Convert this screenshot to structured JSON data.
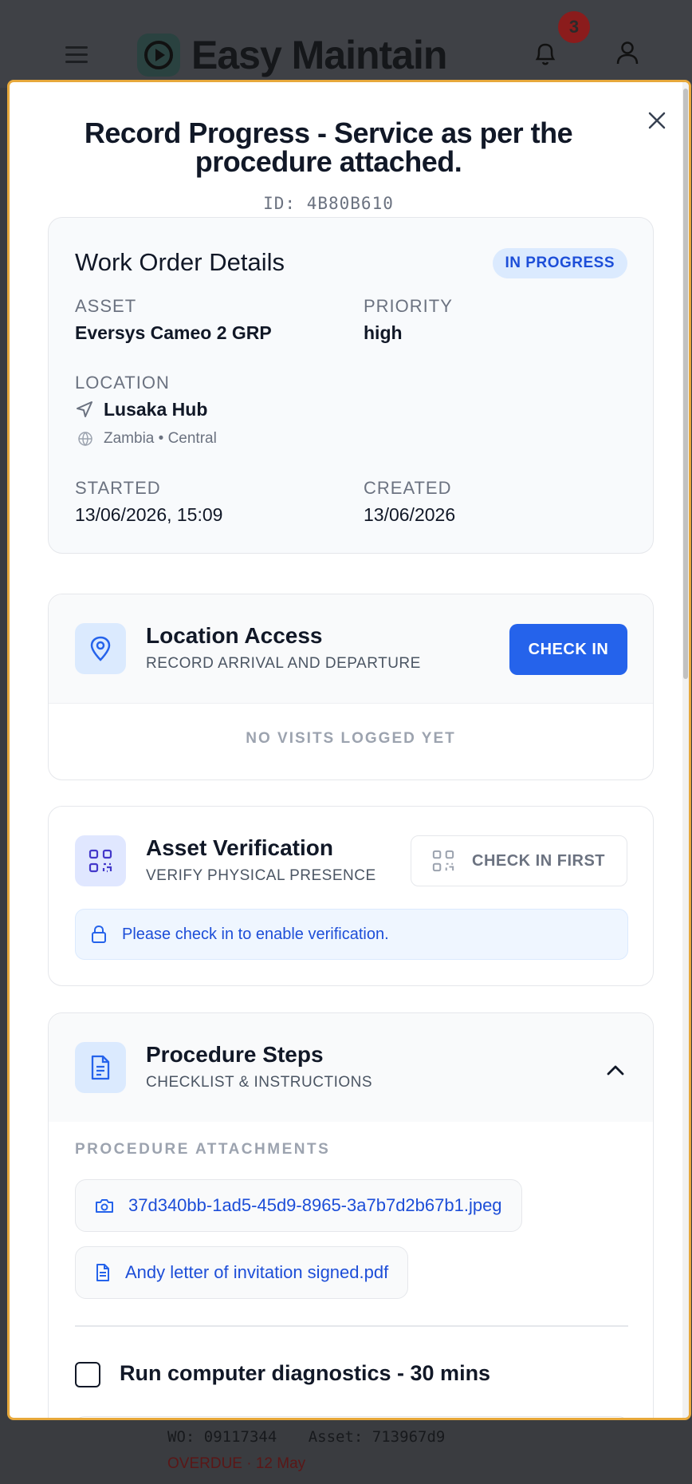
{
  "background_app": {
    "title": "Easy Maintain",
    "notification_count": "3",
    "footer_wo": "WO: 09117344",
    "footer_asset": "Asset: 713967d9",
    "footer_overdue": "OVERDUE · 12 May"
  },
  "modal": {
    "title": "Record Progress - Service as per the procedure attached.",
    "id_text": "ID: 4B80B610"
  },
  "details": {
    "title": "Work Order Details",
    "status": "IN PROGRESS",
    "asset_label": "ASSET",
    "asset_value": "Eversys Cameo 2 GRP",
    "priority_label": "PRIORITY",
    "priority_value": "high",
    "location_label": "LOCATION",
    "location_name": "Lusaka Hub",
    "location_region": "Zambia • Central",
    "started_label": "STARTED",
    "started_value": "13/06/2026, 15:09",
    "created_label": "CREATED",
    "created_value": "13/06/2026"
  },
  "location_access": {
    "title": "Location Access",
    "subtitle": "RECORD ARRIVAL AND DEPARTURE",
    "button": "CHECK IN",
    "empty": "NO VISITS LOGGED YET"
  },
  "asset_verification": {
    "title": "Asset Verification",
    "subtitle": "VERIFY PHYSICAL PRESENCE",
    "button": "CHECK IN FIRST",
    "notice": "Please check in to enable verification."
  },
  "procedure": {
    "title": "Procedure Steps",
    "subtitle": "CHECKLIST & INSTRUCTIONS",
    "attachments_label": "PROCEDURE ATTACHMENTS",
    "attachments": [
      {
        "name": "37d340bb-1ad5-45d9-8965-3a7b7d2b67b1.jpeg",
        "icon": "camera-icon"
      },
      {
        "name": "Andy letter of invitation signed.pdf",
        "icon": "document-icon"
      }
    ],
    "step_1": "Run computer diagnostics - 30 mins"
  },
  "colors": {
    "accent": "#2563eb",
    "modal_border": "#e7a83b",
    "badge_bg": "#dbeafe"
  }
}
